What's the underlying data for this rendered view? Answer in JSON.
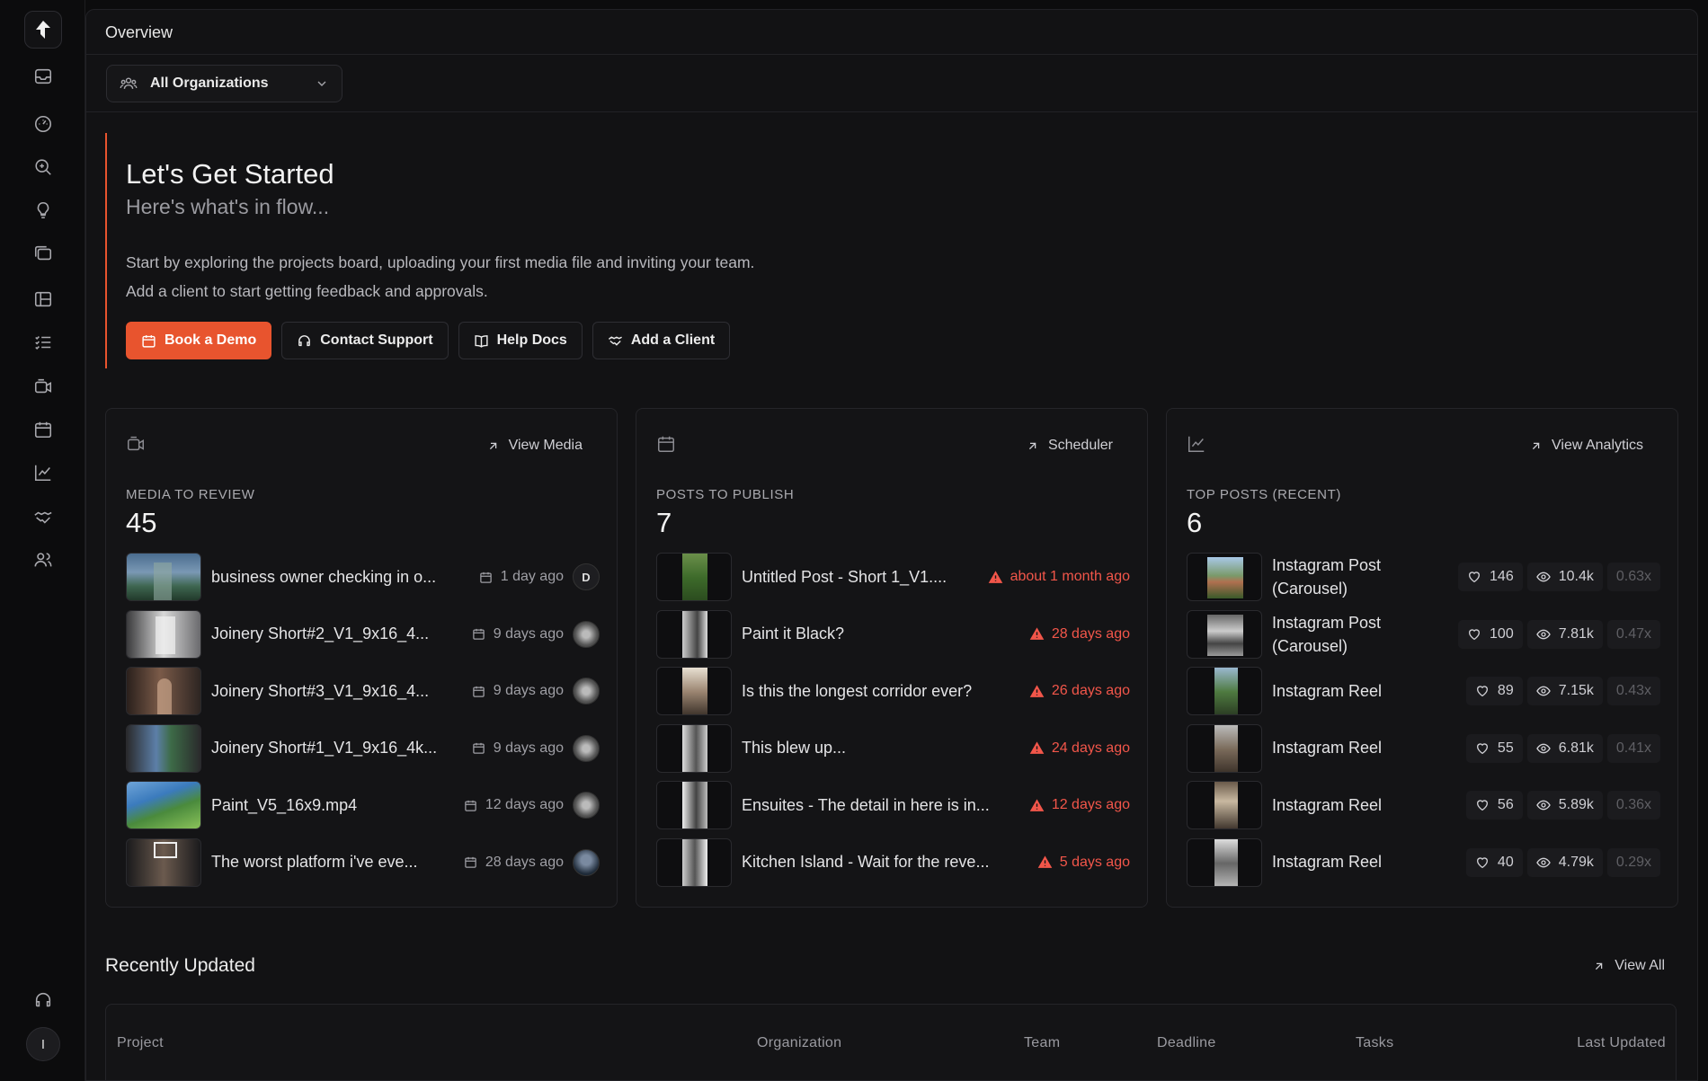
{
  "topbar": {
    "title": "Overview"
  },
  "org_selector": {
    "label": "All Organizations"
  },
  "hero": {
    "title": "Let's Get Started",
    "subtitle": "Here's what's in flow...",
    "line1": "Start by exploring the projects board, uploading your first media file and inviting your team.",
    "line2": "Add a client to start getting feedback and approvals.",
    "buttons": {
      "demo": "Book a Demo",
      "support": "Contact Support",
      "docs": "Help Docs",
      "client": "Add a Client"
    }
  },
  "media": {
    "link": "View Media",
    "label": "MEDIA TO REVIEW",
    "count": "45",
    "items": [
      {
        "title": "business owner checking in o...",
        "date": "1 day ago",
        "avatar": "D"
      },
      {
        "title": "Joinery Short#2_V1_9x16_4...",
        "date": "9 days ago",
        "avatar": ""
      },
      {
        "title": "Joinery Short#3_V1_9x16_4...",
        "date": "9 days ago",
        "avatar": ""
      },
      {
        "title": "Joinery Short#1_V1_9x16_4k...",
        "date": "9 days ago",
        "avatar": ""
      },
      {
        "title": "Paint_V5_16x9.mp4",
        "date": "12 days ago",
        "avatar": ""
      },
      {
        "title": "The worst platform i've eve...",
        "date": "28 days ago",
        "avatar": ""
      }
    ]
  },
  "posts": {
    "link": "Scheduler",
    "label": "POSTS TO PUBLISH",
    "count": "7",
    "items": [
      {
        "title": "Untitled Post - Short 1_V1....",
        "due": "about 1 month ago"
      },
      {
        "title": "Paint it Black?",
        "due": "28 days ago"
      },
      {
        "title": "Is this the longest corridor ever?",
        "due": "26 days ago"
      },
      {
        "title": "This blew up...",
        "due": "24 days ago"
      },
      {
        "title": "Ensuites - The detail in here is in...",
        "due": "12 days ago"
      },
      {
        "title": "Kitchen Island - Wait for the reve...",
        "due": "5 days ago"
      }
    ]
  },
  "top_posts": {
    "link": "View Analytics",
    "label": "TOP POSTS (RECENT)",
    "count": "6",
    "items": [
      {
        "title": "Instagram Post (Carousel)",
        "likes": "146",
        "views": "10.4k",
        "ratio": "0.63x"
      },
      {
        "title": "Instagram Post (Carousel)",
        "likes": "100",
        "views": "7.81k",
        "ratio": "0.47x"
      },
      {
        "title": "Instagram Reel",
        "likes": "89",
        "views": "7.15k",
        "ratio": "0.43x"
      },
      {
        "title": "Instagram Reel",
        "likes": "55",
        "views": "6.81k",
        "ratio": "0.41x"
      },
      {
        "title": "Instagram Reel",
        "likes": "56",
        "views": "5.89k",
        "ratio": "0.36x"
      },
      {
        "title": "Instagram Reel",
        "likes": "40",
        "views": "4.79k",
        "ratio": "0.29x"
      }
    ]
  },
  "recent": {
    "title": "Recently Updated",
    "link": "View All",
    "columns": [
      "Project",
      "Organization",
      "Team",
      "Deadline",
      "Tasks",
      "Last Updated"
    ]
  },
  "user": {
    "initial": "I"
  },
  "colors": {
    "accent": "#e8542e",
    "warning": "#f2564a",
    "background": "#0c0c0d",
    "panel": "#141416"
  }
}
